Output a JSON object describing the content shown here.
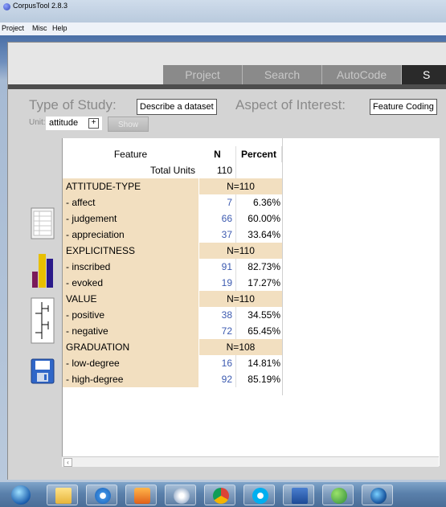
{
  "window": {
    "title": "CorpusTool 2.8.3"
  },
  "menu": [
    "Project",
    "Misc",
    "Help"
  ],
  "tabs": [
    {
      "label": "Project",
      "active": false
    },
    {
      "label": "Search",
      "active": false
    },
    {
      "label": "AutoCode",
      "active": false
    },
    {
      "label": "S",
      "active": true
    }
  ],
  "study": {
    "type_label": "Type of Study:",
    "type_value": "Describe a dataset",
    "aspect_label": "Aspect of Interest:",
    "aspect_value": "Feature Coding"
  },
  "unit": {
    "label": "Unit:",
    "value": "attitude",
    "plus": "+"
  },
  "show_button": "Show",
  "table": {
    "headers": {
      "feature": "Feature",
      "n": "N",
      "percent": "Percent"
    },
    "total": {
      "label": "Total Units",
      "n": "110"
    },
    "rows": [
      {
        "kind": "cat",
        "feature": "ATTITUDE-TYPE",
        "np": "N=110"
      },
      {
        "kind": "item",
        "feature": "- affect",
        "n": "7",
        "p": "6.36%"
      },
      {
        "kind": "item",
        "feature": "- judgement",
        "n": "66",
        "p": "60.00%"
      },
      {
        "kind": "item",
        "feature": "- appreciation",
        "n": "37",
        "p": "33.64%"
      },
      {
        "kind": "cat",
        "feature": "EXPLICITNESS",
        "np": "N=110"
      },
      {
        "kind": "item",
        "feature": "- inscribed",
        "n": "91",
        "p": "82.73%"
      },
      {
        "kind": "item",
        "feature": "- evoked",
        "n": "19",
        "p": "17.27%"
      },
      {
        "kind": "cat",
        "feature": "VALUE",
        "np": "N=110"
      },
      {
        "kind": "item",
        "feature": "- positive",
        "n": "38",
        "p": "34.55%"
      },
      {
        "kind": "item",
        "feature": "- negative",
        "n": "72",
        "p": "65.45%"
      },
      {
        "kind": "cat",
        "feature": "GRADUATION",
        "np": "N=108"
      },
      {
        "kind": "item",
        "feature": "- low-degree",
        "n": "16",
        "p": "14.81%"
      },
      {
        "kind": "item",
        "feature": "- high-degree",
        "n": "92",
        "p": "85.19%"
      }
    ]
  },
  "scroll_arrow": "‹",
  "colors": {
    "feature_cell": "#f2dfc0",
    "count_text": "#3c5ab0",
    "active_tab": "#2a2a2a"
  },
  "sidebar_icons": [
    "table-view-icon",
    "bar-chart-icon",
    "tree-view-icon",
    "save-icon"
  ],
  "taskbar_icons": [
    "windows-start-icon",
    "file-explorer-icon",
    "internet-explorer-icon",
    "media-player-icon",
    "app-icon",
    "chrome-icon",
    "skype-icon",
    "word-icon",
    "users-icon",
    "browser-icon"
  ]
}
